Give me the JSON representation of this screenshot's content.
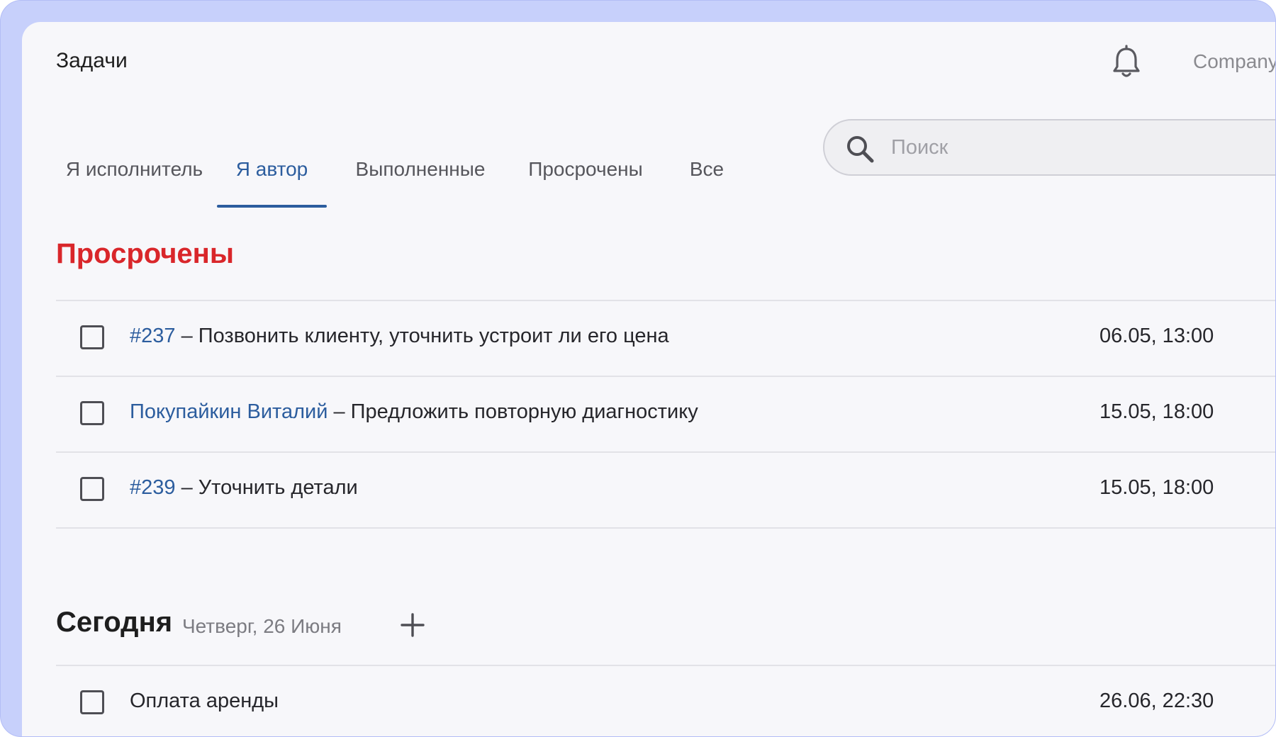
{
  "header": {
    "title": "Задачи",
    "company": "Company"
  },
  "tabs": [
    {
      "label": "Я исполнитель",
      "active": false
    },
    {
      "label": "Я автор",
      "active": true
    },
    {
      "label": "Выполненные",
      "active": false
    },
    {
      "label": "Просрочены",
      "active": false
    },
    {
      "label": "Все",
      "active": false
    }
  ],
  "search": {
    "placeholder": "Поиск",
    "value": ""
  },
  "overdue": {
    "title": "Просрочены",
    "tasks": [
      {
        "link": "#237",
        "text": " – Позвонить клиенту, уточнить устроит ли его цена",
        "date": "06.05, 13:00",
        "checked": false
      },
      {
        "link": "Покупайкин Виталий",
        "text": " – Предложить повторную диагностику",
        "date": "15.05, 18:00",
        "checked": false
      },
      {
        "link": "#239",
        "text": " – Уточнить детали",
        "date": "15.05, 18:00",
        "checked": false
      }
    ]
  },
  "today": {
    "title": "Сегодня",
    "date": "Четверг, 26 Июня",
    "tasks": [
      {
        "link": "",
        "text": "Оплата аренды",
        "date": "26.06, 22:30",
        "checked": false
      }
    ]
  },
  "icons": {
    "bell": "bell-icon",
    "search": "search-icon",
    "add": "plus-icon"
  },
  "colors": {
    "accent": "#2c5d9e",
    "overdue": "#d9262a",
    "frame": "#c7d0fb",
    "background": "#f7f7fa"
  }
}
